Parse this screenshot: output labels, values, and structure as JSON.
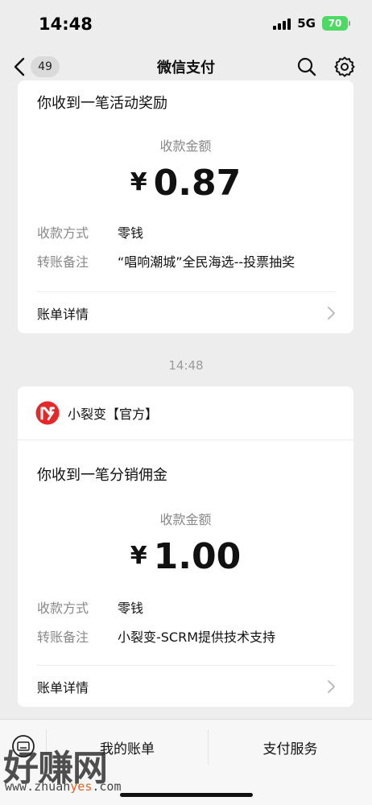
{
  "status_bar": {
    "time": "14:48",
    "network": "5G",
    "battery": "70"
  },
  "nav": {
    "unread_count": "49",
    "title": "微信支付"
  },
  "messages": [
    {
      "title": "你收到一笔活动奖励",
      "amount_label": "收款金额",
      "currency": "¥",
      "amount": "0.87",
      "rows": [
        {
          "label": "收款方式",
          "value": "零钱"
        },
        {
          "label": "转账备注",
          "value": "“唱响潮城”全民海选--投票抽奖"
        }
      ],
      "detail_label": "账单详情"
    },
    {
      "brand": "小裂变【官方】",
      "title": "你收到一笔分销佣金",
      "amount_label": "收款金额",
      "currency": "¥",
      "amount": "1.00",
      "rows": [
        {
          "label": "收款方式",
          "value": "零钱"
        },
        {
          "label": "转账备注",
          "value": "小裂变-SCRM提供技术支持"
        }
      ],
      "detail_label": "账单详情"
    }
  ],
  "timestamp": "14:48",
  "bottom_menu": {
    "left": "我的账单",
    "right": "支付服务"
  },
  "watermark": {
    "text": "好赚网",
    "url_prefix": "www.zhuan",
    "url_highlight": "yes",
    "url_suffix": ".com"
  },
  "colors": {
    "background": "#ededed",
    "card": "#ffffff",
    "battery": "#4cd964",
    "brand_red": "#e5282a"
  }
}
